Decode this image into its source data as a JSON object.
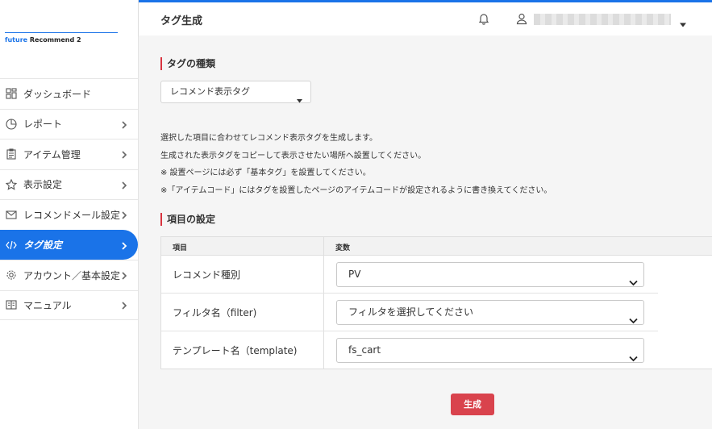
{
  "sidebar": {
    "logo_brand": "future",
    "logo_rest": " Recommend 2",
    "items": [
      {
        "label": "ダッシュボード",
        "icon": "dashboard-icon",
        "chevron": false
      },
      {
        "label": "レポート",
        "icon": "pie-chart-icon",
        "chevron": true
      },
      {
        "label": "アイテム管理",
        "icon": "clipboard-icon",
        "chevron": true
      },
      {
        "label": "表示設定",
        "icon": "star-icon",
        "chevron": true
      },
      {
        "label": "レコメンドメール設定",
        "icon": "mail-icon",
        "chevron": true
      },
      {
        "label": "タグ設定",
        "icon": "code-icon",
        "chevron": true,
        "active": true
      },
      {
        "label": "アカウント／基本設定",
        "icon": "gear-icon",
        "chevron": true
      },
      {
        "label": "マニュアル",
        "icon": "book-icon",
        "chevron": true
      }
    ]
  },
  "header": {
    "title": "タグ生成",
    "user_name": "████████████████████"
  },
  "main": {
    "tag_type_heading": "タグの種類",
    "tag_type_value": "レコメンド表示タグ",
    "description": [
      "選択した項目に合わせてレコメンド表示タグを生成します。",
      "生成された表示タグをコピーして表示させたい場所へ設置してください。",
      "※ 設置ページには必ず「基本タグ」を設置してください。",
      "※「アイテムコード」にはタグを設置したページのアイテムコードが設定されるように書き換えてください。"
    ],
    "settings_heading": "項目の設定",
    "table": {
      "col_item": "項目",
      "col_var": "変数",
      "rows": [
        {
          "label": "レコメンド種別",
          "value": "PV"
        },
        {
          "label": "フィルタ名（filter)",
          "value": "フィルタを選択してください"
        },
        {
          "label": "テンプレート名（template)",
          "value": "fs_cart"
        }
      ]
    },
    "generate_label": "生成"
  },
  "colors": {
    "accent": "#1a73e8",
    "section_marker": "#d9333f",
    "generate_button": "#d9434d"
  }
}
